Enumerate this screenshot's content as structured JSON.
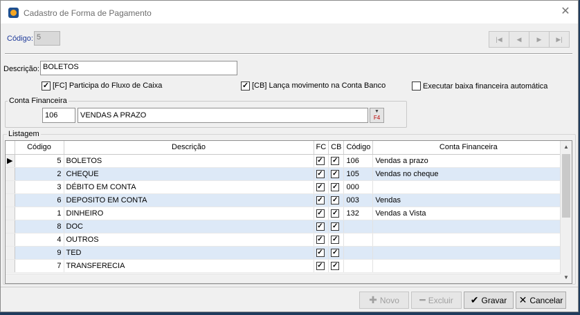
{
  "window": {
    "title": "Cadastro de Forma de Pagamento",
    "close_glyph": "✕"
  },
  "codigo": {
    "label": "Código:",
    "value": "5"
  },
  "nav": {
    "first": "|◀",
    "prev": "◀",
    "next": "▶",
    "last": "▶|"
  },
  "descricao": {
    "label": "Descrição:",
    "value": "BOLETOS"
  },
  "checkboxes": {
    "fc": {
      "label": "[FC] Participa do Fluxo de Caixa",
      "checked": true,
      "mark": "✓"
    },
    "cb": {
      "label": "[CB] Lança movimento na Conta Banco",
      "checked": true,
      "mark": "✓"
    },
    "auto": {
      "label": "Executar baixa financeira automática",
      "checked": false,
      "mark": ""
    }
  },
  "conta_financeira": {
    "label": "Conta Financeira",
    "code": "106",
    "name": "VENDAS A PRAZO",
    "lookup_arrow": "▼",
    "lookup_key": "F4"
  },
  "listagem": {
    "label": "Listagem",
    "columns": {
      "codigo": "Código",
      "descricao": "Descrição",
      "fc": "FC",
      "cb": "CB",
      "conta_codigo": "Código",
      "conta_nome": "Conta Financeira"
    },
    "row_indicator": "▶",
    "check_mark": "✓",
    "rows": [
      {
        "codigo": "5",
        "descricao": "BOLETOS",
        "fc": true,
        "cb": true,
        "conta_codigo": "106",
        "conta_nome": "Vendas a prazo"
      },
      {
        "codigo": "2",
        "descricao": "CHEQUE",
        "fc": true,
        "cb": true,
        "conta_codigo": "105",
        "conta_nome": "Vendas no cheque"
      },
      {
        "codigo": "3",
        "descricao": "DÉBITO EM CONTA",
        "fc": true,
        "cb": true,
        "conta_codigo": "000",
        "conta_nome": ""
      },
      {
        "codigo": "6",
        "descricao": "DEPOSITO EM CONTA",
        "fc": true,
        "cb": true,
        "conta_codigo": "003",
        "conta_nome": "Vendas"
      },
      {
        "codigo": "1",
        "descricao": "DINHEIRO",
        "fc": true,
        "cb": true,
        "conta_codigo": "132",
        "conta_nome": "Vendas a Vista"
      },
      {
        "codigo": "8",
        "descricao": "DOC",
        "fc": true,
        "cb": true,
        "conta_codigo": "",
        "conta_nome": ""
      },
      {
        "codigo": "4",
        "descricao": "OUTROS",
        "fc": true,
        "cb": true,
        "conta_codigo": "",
        "conta_nome": ""
      },
      {
        "codigo": "9",
        "descricao": "TED",
        "fc": true,
        "cb": true,
        "conta_codigo": "",
        "conta_nome": ""
      },
      {
        "codigo": "7",
        "descricao": "TRANSFERECIA",
        "fc": true,
        "cb": true,
        "conta_codigo": "",
        "conta_nome": ""
      }
    ],
    "scroll_up": "▲",
    "scroll_down": "▼"
  },
  "buttons": {
    "novo": {
      "label": "Novo",
      "icon": "✚"
    },
    "excluir": {
      "label": "Excluir",
      "icon": "━"
    },
    "gravar": {
      "label": "Gravar",
      "icon": "✔"
    },
    "cancelar": {
      "label": "Cancelar",
      "icon": "✕"
    }
  }
}
